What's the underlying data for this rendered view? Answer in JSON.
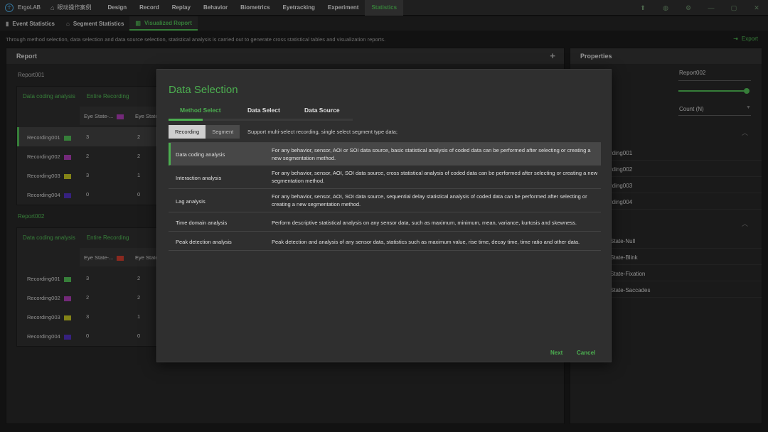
{
  "app": {
    "title": "ErgoLAB",
    "project": "眼动操作案例"
  },
  "menu": [
    "Design",
    "Record",
    "Replay",
    "Behavior",
    "Biometrics",
    "Eyetracking",
    "Experiment",
    "Statistics"
  ],
  "subtabs": [
    "Event Statistics",
    "Segment Statistics",
    "Visualized Report"
  ],
  "description": "Through method selection, data selection and data source selection, statistical analysis is carried out to generate cross statistical tables and visualization reports.",
  "export_label": "Export",
  "report_panel": {
    "title": "Report",
    "reports": [
      {
        "name": "Report001",
        "method": "Data coding analysis",
        "scope": "Entire Recording",
        "columns": [
          "Eye State-...",
          "Eye State"
        ],
        "rows": [
          {
            "label": "Recording001",
            "v1": "3",
            "v2": "2"
          },
          {
            "label": "Recording002",
            "v1": "2",
            "v2": "2"
          },
          {
            "label": "Recording003",
            "v1": "3",
            "v2": "1"
          },
          {
            "label": "Recording004",
            "v1": "0",
            "v2": "0"
          }
        ]
      },
      {
        "name": "Report002",
        "method": "Data coding analysis",
        "scope": "Entire Recording",
        "columns": [
          "Eye State-...",
          "Eye State"
        ],
        "rows": [
          {
            "label": "Recording001",
            "v1": "3",
            "v2": "2"
          },
          {
            "label": "Recording002",
            "v1": "2",
            "v2": "2"
          },
          {
            "label": "Recording003",
            "v1": "3",
            "v2": "1"
          },
          {
            "label": "Recording004",
            "v1": "0",
            "v2": "0"
          }
        ]
      }
    ]
  },
  "properties": {
    "title": "Properties",
    "name_value": "Report002",
    "slider_fraction": 1.0,
    "unit_value": "Count (N)",
    "recordings": [
      "rding001",
      "rding002",
      "rding003",
      "rding004"
    ],
    "states": [
      "State-Null",
      "State-Blink",
      "State-Fixation",
      "State-Saccades"
    ]
  },
  "colors": {
    "accent": "#4caf50",
    "swatch_recording001": "#4caf50",
    "swatch_recording002": "#a03aa8",
    "swatch_recording003": "#b8b820",
    "swatch_recording004": "#4b2fb0",
    "swatch_col_report001": "#a03aa8",
    "swatch_col_report002": "#c0392b"
  },
  "dialog": {
    "title": "Data Selection",
    "tabs": [
      "Method Select",
      "Data Select",
      "Data Source"
    ],
    "toggle": [
      "Recording",
      "Segment"
    ],
    "note": "Support multi-select recording, single select segment type data;",
    "methods": [
      {
        "name": "Data coding analysis",
        "desc": "For any behavior, sensor, AOI or SOI data source, basic statistical analysis of coded data can be performed after selecting or creating a new segmentation method."
      },
      {
        "name": "Interaction analysis",
        "desc": "For any behavior, sensor, AOI, SOI data source, cross statistical analysis of coded data can be performed after selecting or creating a new segmentation method."
      },
      {
        "name": "Lag analysis",
        "desc": "For any behavior, sensor, AOI, SOI data source, sequential delay statistical analysis of coded data can be performed after selecting or creating a new segmentation method."
      },
      {
        "name": "Time domain analysis",
        "desc": "Perform descriptive statistical analysis on any sensor data, such as maximum, minimum, mean, variance, kurtosis and skewness."
      },
      {
        "name": "Peak detection analysis",
        "desc": "Peak detection and analysis of any sensor data, statistics such as maximum value, rise time, decay time, time ratio and other data."
      }
    ],
    "next_label": "Next",
    "cancel_label": "Cancel"
  }
}
